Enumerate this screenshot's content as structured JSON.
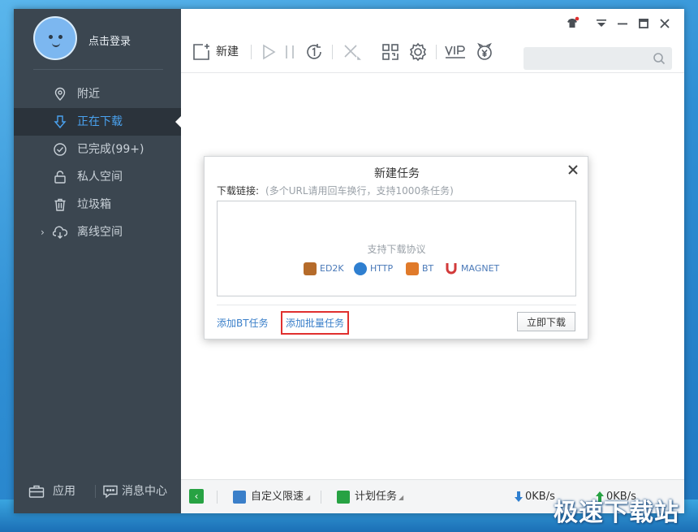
{
  "sidebar": {
    "login_label": "点击登录",
    "items": [
      {
        "label": "附近",
        "icon": "location-pin-icon"
      },
      {
        "label": "正在下载",
        "icon": "download-arrow-icon",
        "active": true
      },
      {
        "label": "已完成(99+)",
        "icon": "check-circle-icon"
      },
      {
        "label": "私人空间",
        "icon": "lock-icon"
      },
      {
        "label": "垃圾箱",
        "icon": "trash-icon"
      },
      {
        "label": "离线空间",
        "icon": "cloud-download-icon",
        "expandable": true
      }
    ],
    "bottom": {
      "apps_label": "应用",
      "messages_label": "消息中心"
    }
  },
  "toolbar": {
    "new_label": "新建",
    "search_placeholder": ""
  },
  "dialog": {
    "title": "新建任务",
    "link_label": "下载链接:",
    "link_hint": "(多个URL请用回车换行，支持1000条任务)",
    "protocols_title": "支持下载协议",
    "protocols": [
      {
        "name": "ED2K",
        "color": "#b56b2a"
      },
      {
        "name": "HTTP",
        "color": "#2f7fd0"
      },
      {
        "name": "BT",
        "color": "#e07a2a"
      },
      {
        "name": "MAGNET",
        "color": "#d23a3a"
      }
    ],
    "add_bt_label": "添加BT任务",
    "add_batch_label": "添加批量任务",
    "download_now_label": "立即下载"
  },
  "statusbar": {
    "speed_limit_label": "自定义限速",
    "schedule_label": "计划任务",
    "download_speed": "0KB/s",
    "upload_speed": "0KB/s"
  },
  "watermark": "极速下载站",
  "colors": {
    "sidebar_bg": "#3b4650",
    "active_item_bg": "#2b333b",
    "accent_blue": "#4aa2ef",
    "link_blue": "#3a7fc9",
    "highlight_red": "#e0302f",
    "status_green": "#27a243"
  }
}
